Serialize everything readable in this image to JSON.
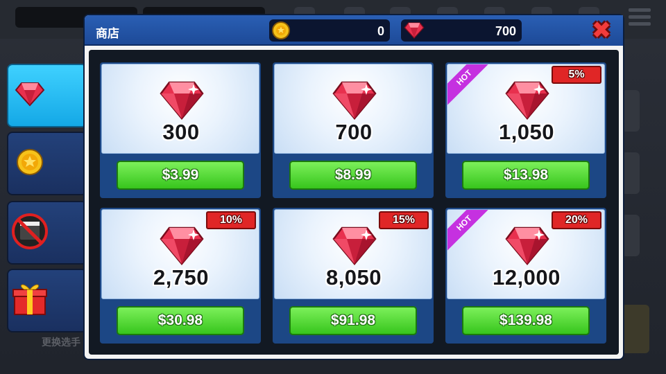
{
  "title": "商店",
  "currencies": {
    "coins": "0",
    "gems": "700"
  },
  "side_tabs": [
    {
      "icon": "gem-icon"
    },
    {
      "icon": "coin-icon"
    },
    {
      "icon": "no-ads-icon"
    },
    {
      "icon": "gift-icon"
    }
  ],
  "background": {
    "bottom_text": "更换选手"
  },
  "products": [
    {
      "amount": "300",
      "price": "$3.99",
      "discount": "",
      "hot": false
    },
    {
      "amount": "700",
      "price": "$8.99",
      "discount": "",
      "hot": false
    },
    {
      "amount": "1,050",
      "price": "$13.98",
      "discount": "5%",
      "hot": true,
      "hot_label": "HOT"
    },
    {
      "amount": "2,750",
      "price": "$30.98",
      "discount": "10%",
      "hot": false
    },
    {
      "amount": "8,050",
      "price": "$91.98",
      "discount": "15%",
      "hot": false
    },
    {
      "amount": "12,000",
      "price": "$139.98",
      "discount": "20%",
      "hot": true,
      "hot_label": "HOT"
    }
  ],
  "colors": {
    "header": "#1d4a98",
    "buy_button": "#37c51d",
    "discount_badge": "#e02626",
    "hot_ribbon": "#c531e0",
    "gem": "#e8304e",
    "active_tab": "#14a8e6"
  }
}
